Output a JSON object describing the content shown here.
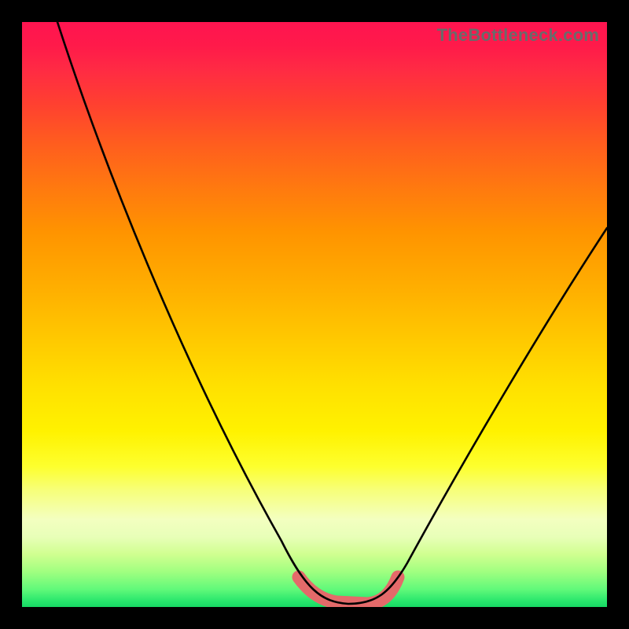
{
  "watermark": "TheBottleneck.com",
  "chart_data": {
    "type": "line",
    "title": "",
    "xlabel": "",
    "ylabel": "",
    "xlim": [
      0,
      100
    ],
    "ylim": [
      0,
      100
    ],
    "grid": false,
    "note": "Axes are unlabeled; values are estimated from pixel positions normalized to 0-100. y=0 is the green bottom, y=100 is the red top.",
    "series": [
      {
        "name": "black-curve",
        "x": [
          6,
          10,
          15,
          20,
          25,
          30,
          35,
          40,
          45,
          48,
          50,
          52,
          55,
          58,
          60,
          62,
          64,
          68,
          72,
          76,
          80,
          85,
          90,
          95,
          100
        ],
        "y": [
          100,
          92,
          82,
          72,
          62,
          52,
          42,
          32,
          20,
          10,
          4,
          2,
          1,
          1,
          1,
          2,
          4,
          10,
          18,
          26,
          33,
          42,
          50,
          58,
          65
        ]
      },
      {
        "name": "pink-bottom-band",
        "x": [
          48,
          50,
          52,
          55,
          58,
          60,
          62,
          64
        ],
        "y": [
          6,
          3,
          2,
          1.5,
          1.5,
          2,
          3,
          6
        ]
      }
    ],
    "colors": {
      "black_curve": "#000000",
      "pink_band": "#e46a6a",
      "gradient_top": "#ff1450",
      "gradient_mid": "#ffe000",
      "gradient_bottom": "#17d964"
    }
  }
}
